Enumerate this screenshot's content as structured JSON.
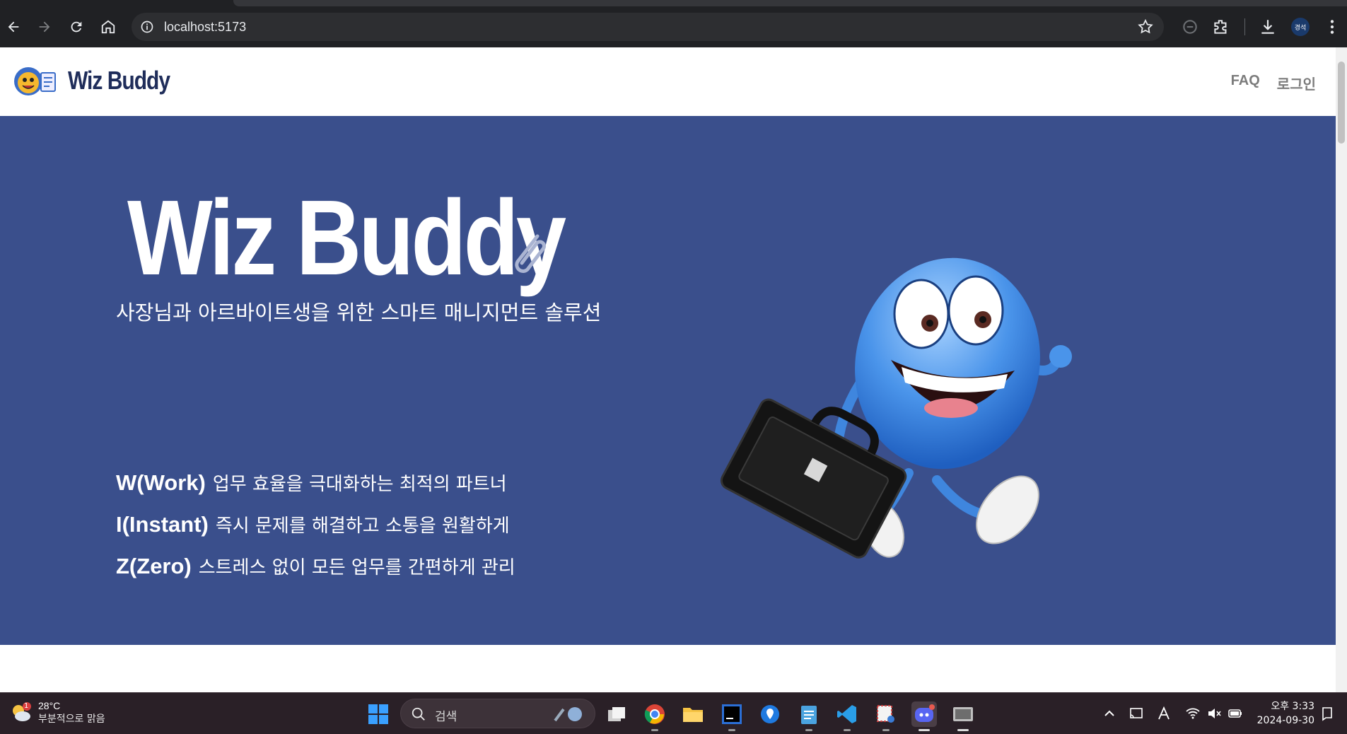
{
  "browser": {
    "url": "localhost:5173",
    "profile_label": "경석"
  },
  "site": {
    "logo_text": "Wiz Buddy",
    "nav": {
      "faq": "FAQ",
      "login": "로그인"
    }
  },
  "hero": {
    "title": "Wiz Buddy",
    "subtitle": "사장님과 아르바이트생을 위한 스마트 매니지먼트 솔루션",
    "features": [
      {
        "key": "W(Work)",
        "desc": "업무 효율을 극대화하는 최적의 파트너"
      },
      {
        "key": "I(Instant)",
        "desc": "즉시 문제를 해결하고 소통을 원활하게"
      },
      {
        "key": "Z(Zero)",
        "desc": "스트레스 없이 모든 업무를 간편하게 관리"
      }
    ],
    "background_color": "#3a4f8c"
  },
  "taskbar": {
    "weather_temp": "28°C",
    "weather_desc": "부분적으로 맑음",
    "weather_badge": "1",
    "search_placeholder": "검색",
    "time": "오후 3:33",
    "date": "2024-09-30"
  },
  "icons": {
    "back": "arrow-left-icon",
    "forward": "arrow-right-icon",
    "reload": "reload-icon",
    "home": "home-icon",
    "bookmark": "star-icon",
    "extensions": "puzzle-icon",
    "download": "download-icon",
    "menu": "kebab-icon"
  }
}
